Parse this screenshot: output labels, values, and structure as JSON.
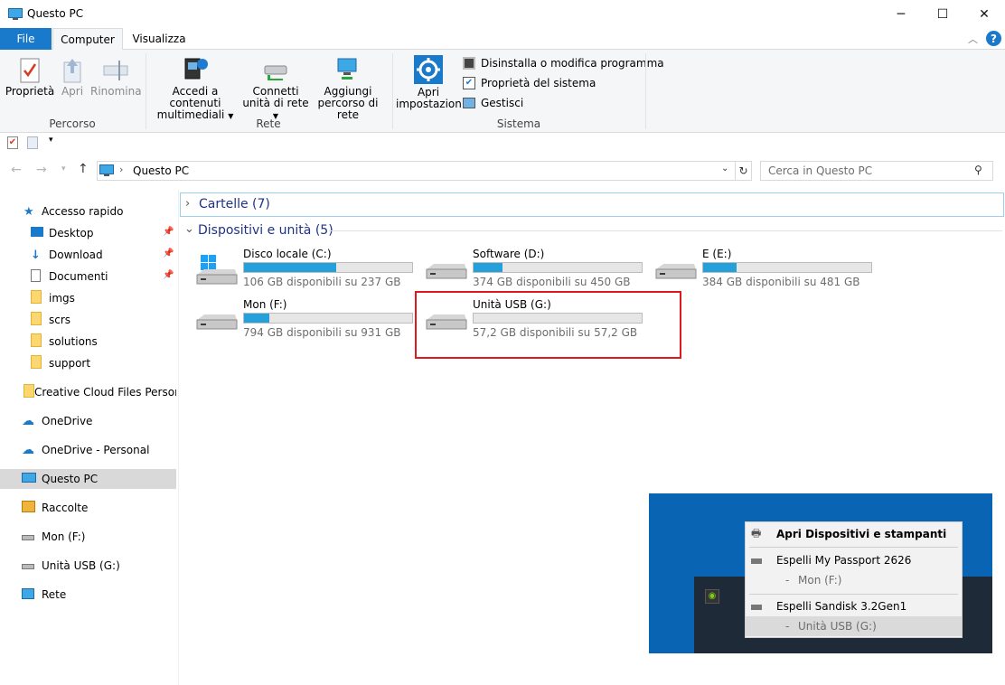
{
  "window": {
    "title": "Questo PC",
    "minimize": "─",
    "maximize": "☐",
    "close": "✕"
  },
  "tabs": [
    {
      "label": "File"
    },
    {
      "label": "Computer"
    },
    {
      "label": "Visualizza"
    }
  ],
  "ribbon": {
    "percorso": {
      "group_label": "Percorso",
      "proprieta": "Proprietà",
      "apri": "Apri",
      "rinomina": "Rinomina"
    },
    "rete": {
      "group_label": "Rete",
      "accedi_line1": "Accedi a contenuti",
      "accedi_line2": "multimediali",
      "connetti_line1": "Connetti",
      "connetti_line2": "unità di rete",
      "aggiungi_line1": "Aggiungi",
      "aggiungi_line2": "percorso di rete"
    },
    "sistema": {
      "group_label": "Sistema",
      "apri_imp_line1": "Apri",
      "apri_imp_line2": "impostazioni",
      "disinstalla": "Disinstalla o modifica programma",
      "proprieta_sistema": "Proprietà del sistema",
      "gestisci": "Gestisci"
    }
  },
  "address": {
    "path": "Questo PC",
    "search_placeholder": "Cerca in Questo PC"
  },
  "nav": {
    "accesso_rapido": "Accesso rapido",
    "items": [
      {
        "label": "Desktop"
      },
      {
        "label": "Download"
      },
      {
        "label": "Documenti"
      },
      {
        "label": "imgs"
      },
      {
        "label": "scrs"
      },
      {
        "label": "solutions"
      },
      {
        "label": "support"
      }
    ],
    "creative_cloud": "Creative Cloud Files Persona",
    "onedrive": "OneDrive",
    "onedrive_personal": "OneDrive - Personal",
    "questo_pc": "Questo PC",
    "raccolte": "Raccolte",
    "mon": "Mon (F:)",
    "usb": "Unità USB (G:)",
    "rete": "Rete"
  },
  "content": {
    "cartelle_header": "Cartelle (7)",
    "dispositivi_header": "Dispositivi e unità (5)",
    "drives": [
      {
        "name": "Disco locale (C:)",
        "sub": "106 GB disponibili su 237 GB",
        "used_fraction": 0.55
      },
      {
        "name": "Software (D:)",
        "sub": "374 GB disponibili su 450 GB",
        "used_fraction": 0.17
      },
      {
        "name": "E (E:)",
        "sub": "384 GB disponibili su 481 GB",
        "used_fraction": 0.2
      },
      {
        "name": "Mon (F:)",
        "sub": "794 GB disponibili su 931 GB",
        "used_fraction": 0.15
      },
      {
        "name": "Unità USB (G:)",
        "sub": "57,2 GB disponibili su 57,2 GB",
        "used_fraction": 0.0
      }
    ],
    "highlight_color": "#e0191e"
  },
  "popup": {
    "apri_dispositivi": "Apri Dispositivi e stampanti",
    "espelli_passport": "Espelli My Passport 2626",
    "mon_sub": "Mon (F:)",
    "espelli_sandisk": "Espelli Sandisk 3.2Gen1",
    "usb_sub": "Unità USB (G:)",
    "dash": "-"
  }
}
